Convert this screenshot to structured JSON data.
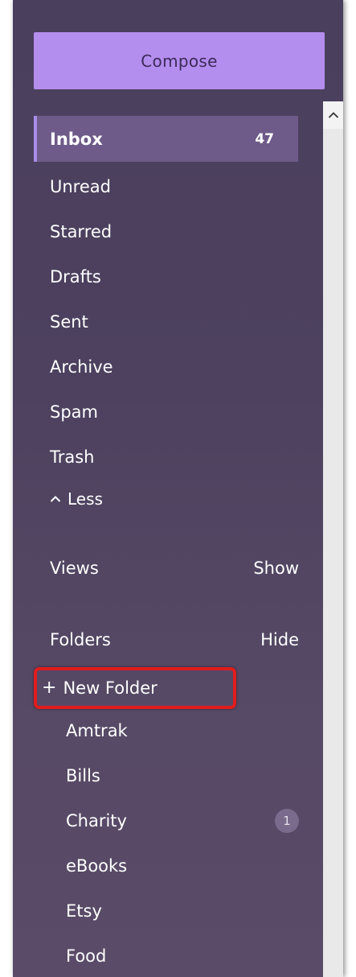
{
  "compose": {
    "label": "Compose"
  },
  "nav": {
    "items": [
      {
        "label": "Inbox",
        "count": "47",
        "active": true
      },
      {
        "label": "Unread"
      },
      {
        "label": "Starred"
      },
      {
        "label": "Drafts"
      },
      {
        "label": "Sent"
      },
      {
        "label": "Archive"
      },
      {
        "label": "Spam"
      },
      {
        "label": "Trash"
      }
    ],
    "less_label": "Less"
  },
  "views": {
    "label": "Views",
    "action": "Show"
  },
  "folders": {
    "label": "Folders",
    "action": "Hide",
    "new_folder_label": "New Folder",
    "items": [
      {
        "label": "Amtrak"
      },
      {
        "label": "Bills"
      },
      {
        "label": "Charity",
        "badge": "1"
      },
      {
        "label": "eBooks"
      },
      {
        "label": "Etsy"
      },
      {
        "label": "Food"
      }
    ]
  },
  "colors": {
    "compose_bg": "#b48eee",
    "panel_bg": "#4d415f",
    "active_bg": "#6e5b89",
    "highlight_border": "#e01c1c"
  },
  "icons": {
    "less": "chevron-up-icon",
    "new_folder": "plus-icon",
    "scroll_up": "chevron-up-icon"
  }
}
